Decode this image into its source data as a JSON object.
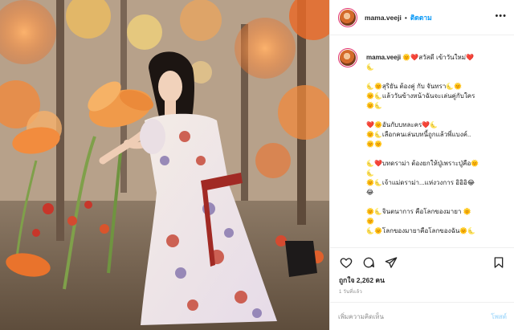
{
  "header": {
    "username": "mama.veeji",
    "separator": "•",
    "follow_label": "ติดตาม",
    "more_icon": "more-options-icon"
  },
  "caption": {
    "username": "mama.veeji",
    "lines": [
      "🌞❤️สวัสดี เข้าวันใหม่❤️",
      "🌜",
      "",
      "🌜🌞สุริยัน ต้องคู่ กับ จันทรา🌜🌞",
      "🌞🌜แล้ววันข้างหน้าฉันจะเล่นคู่กับใคร",
      "🌞🌜",
      "",
      "❤️🌞อันกับบทละคร❤️🌜",
      "🌞🌜เลือกคนเล่นบทนี้ถูกแล้วพี่แบงค์..",
      "🌞🌞",
      "",
      "🌜❤️บทดราม่า ต้องยกให้ปู่เพราะปู่คือ🌞",
      "🌜",
      "🌞🌜เจ้าแม่ดราม่า...แห่งวงการ อิอิอิ😂",
      "😂",
      "",
      "🌞🌜จินตนาการ คือโลกของมายา 🌞",
      "🌞",
      "🌜🌞โลกของมายาคือโลกของฉัน🌞🌜"
    ]
  },
  "actions": {
    "like_icon": "heart-icon",
    "comment_icon": "comment-icon",
    "share_icon": "share-icon",
    "save_icon": "bookmark-icon"
  },
  "likes": {
    "label": "ถูกใจ 2,262 คน"
  },
  "timestamp": "1 วันที่แล้ว",
  "comment": {
    "placeholder": "เพิ่มความคิดเห็น",
    "post_label": "โพสต์"
  },
  "colors": {
    "link_blue": "#0095f6",
    "text": "#262626",
    "muted": "#8e8e8e",
    "post_disabled": "#b2dffc"
  }
}
